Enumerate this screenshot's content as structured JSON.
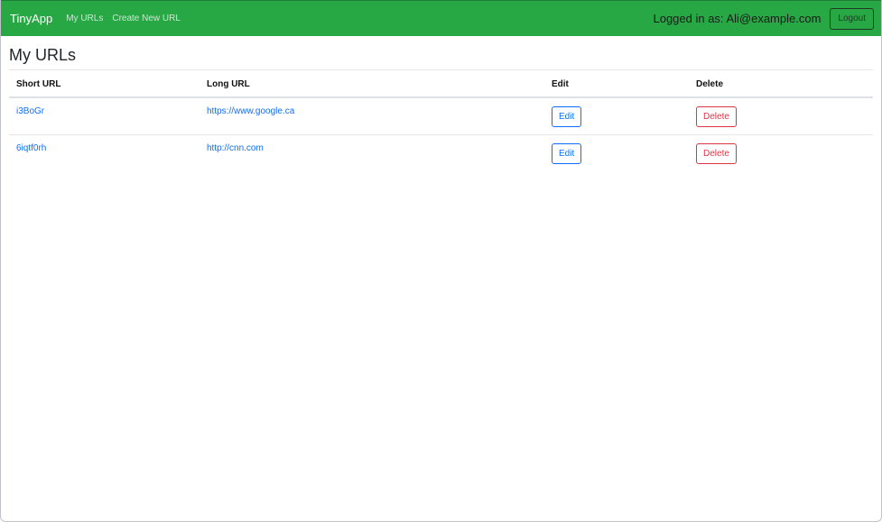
{
  "navbar": {
    "brand": "TinyApp",
    "links": [
      "My URLs",
      "Create New URL"
    ],
    "login_text": "Logged in as: Ali@example.com",
    "logout_label": "Logout"
  },
  "main": {
    "title": "My URLs",
    "table": {
      "headers": [
        "Short URL",
        "Long URL",
        "Edit",
        "Delete"
      ],
      "rows": [
        {
          "short": "i3BoGr",
          "long": "https://www.google.ca",
          "edit": "Edit",
          "delete": "Delete"
        },
        {
          "short": "6iqtf0rh",
          "long": "http://cnn.com",
          "edit": "Edit",
          "delete": "Delete"
        }
      ]
    }
  },
  "colors": {
    "navbar_bg": "#28a745",
    "link": "#0d6efd",
    "danger": "#dc3545"
  }
}
